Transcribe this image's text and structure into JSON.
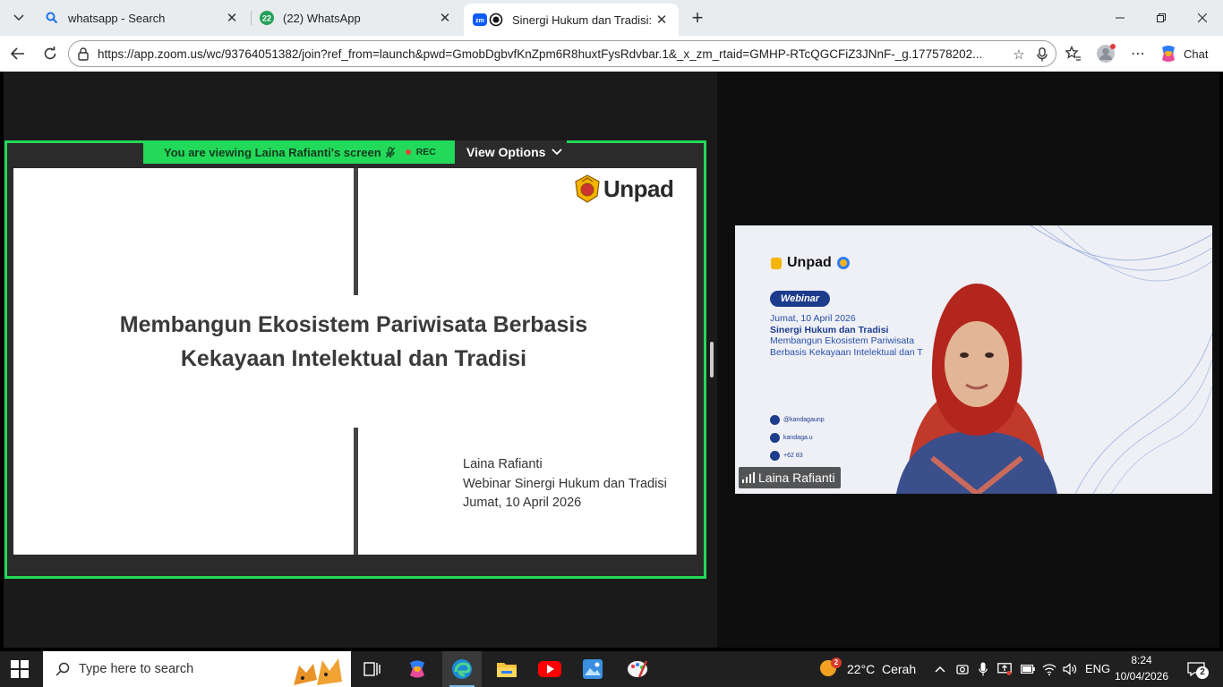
{
  "browser": {
    "tabs": [
      {
        "title": "whatsapp - Search",
        "favicon": "search-icon"
      },
      {
        "title": "(22) WhatsApp",
        "favicon": "whatsapp-icon",
        "badge": "22"
      },
      {
        "title": "Sinergi Hukum dan Tradisi: Me",
        "favicon": "zoom-icon",
        "active": true
      }
    ],
    "url": "https://app.zoom.us/wc/93764051382/join?ref_from=launch&pwd=GmobDgbvfKnZpm6R8huxtFysRdvbar.1&_x_zm_rtaid=GMHP-RTcQGCFiZ3JNnF-_g.177578202...",
    "chat_label": "Chat"
  },
  "zoom": {
    "viewing_label": "You are viewing  Laina Rafianti's screen",
    "rec_label": "REC",
    "view_options_label": "View Options",
    "slide": {
      "logo_text": "Unpad",
      "title_line1": "Membangun Ekosistem Pariwisata Berbasis",
      "title_line2": "Kekayaan Intelektual dan Tradisi",
      "presenter": "Laina Rafianti",
      "event": "Webinar Sinergi Hukum dan Tradisi",
      "date": "Jumat, 10 April 2026"
    },
    "video": {
      "participant_name": "Laina Rafianti",
      "bg_logo_text": "Unpad",
      "bg_pill": "Webinar",
      "bg_date": "Jumat, 10 April 2026",
      "bg_title": "Sinergi Hukum dan Tradisi",
      "bg_sub1": "Membangun Ekosistem Pariwisata",
      "bg_sub2": "Berbasis Kekayaan Intelektual dan T",
      "bg_social1": "@kandagaunp",
      "bg_social2": "kandaga.u",
      "bg_social3": "+62 83"
    }
  },
  "taskbar": {
    "search_placeholder": "Type here to search",
    "weather_temp": "22°C",
    "weather_text": "Cerah",
    "weather_badge": "2",
    "language": "ENG",
    "time": "8:24",
    "date": "10/04/2026",
    "notification_count": "2"
  }
}
